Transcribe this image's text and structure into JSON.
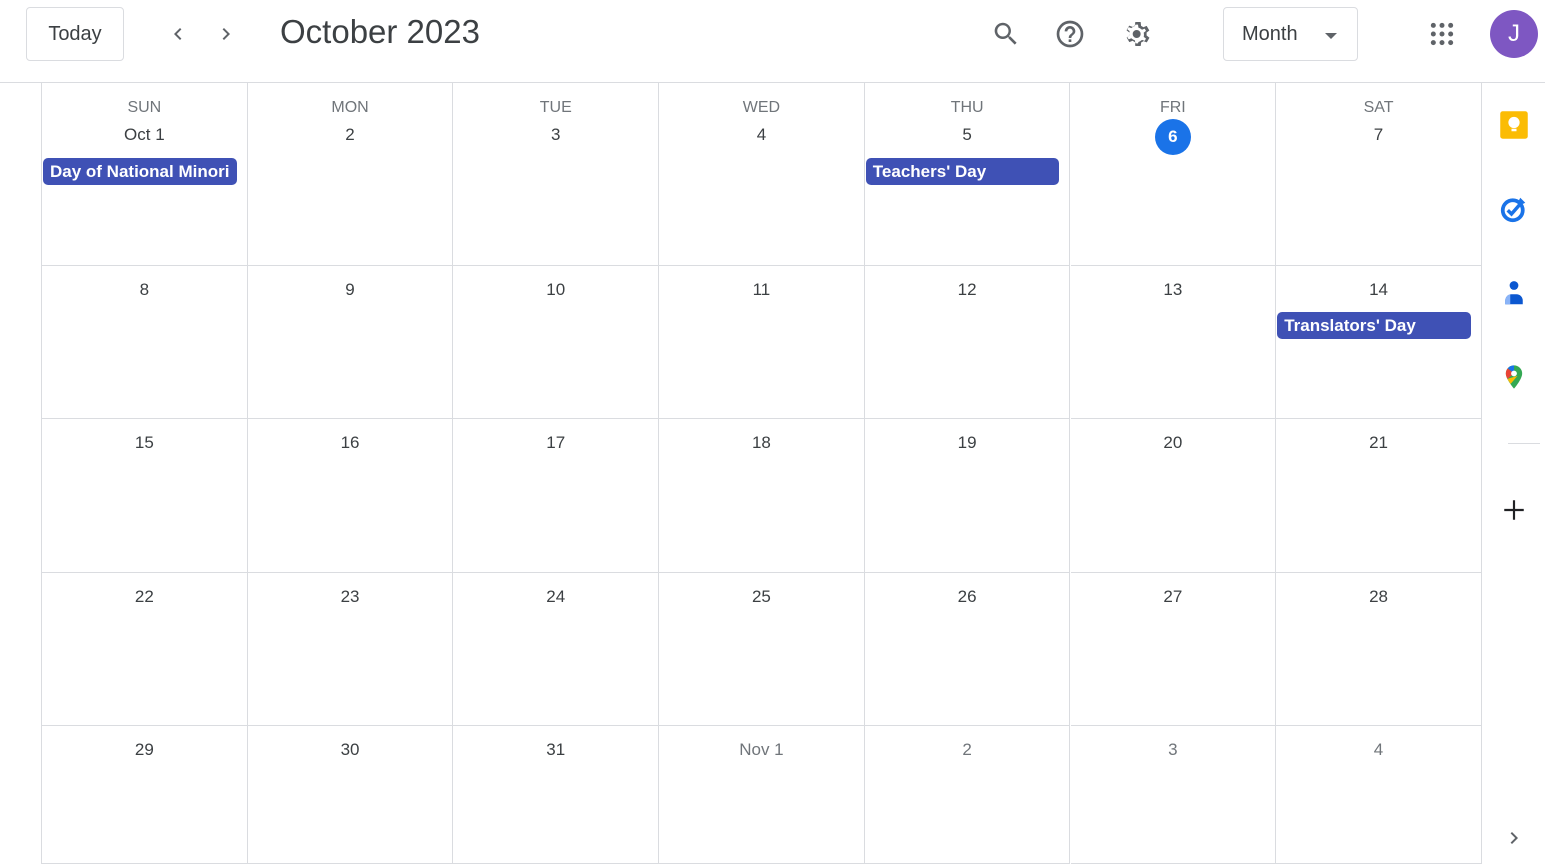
{
  "header": {
    "today_label": "Today",
    "prev_icon": "chevron-left-icon",
    "next_icon": "chevron-right-icon",
    "title": "October 2023",
    "search_icon": "search-icon",
    "help_icon": "help-icon",
    "settings_icon": "gear-icon",
    "view_selected": "Month",
    "apps_icon": "apps-grid-icon",
    "avatar_initial": "J",
    "avatar_color": "#7e57c2"
  },
  "calendar": {
    "weekdays": [
      "SUN",
      "MON",
      "TUE",
      "WED",
      "THU",
      "FRI",
      "SAT"
    ],
    "today_color": "#1a73e8",
    "event_color": "#3f51b5",
    "weeks": [
      [
        {
          "label": "Oct 1"
        },
        {
          "label": "2"
        },
        {
          "label": "3"
        },
        {
          "label": "4"
        },
        {
          "label": "5"
        },
        {
          "label": "6",
          "today": true
        },
        {
          "label": "7"
        }
      ],
      [
        {
          "label": "8"
        },
        {
          "label": "9"
        },
        {
          "label": "10"
        },
        {
          "label": "11"
        },
        {
          "label": "12"
        },
        {
          "label": "13"
        },
        {
          "label": "14"
        }
      ],
      [
        {
          "label": "15"
        },
        {
          "label": "16"
        },
        {
          "label": "17"
        },
        {
          "label": "18"
        },
        {
          "label": "19"
        },
        {
          "label": "20"
        },
        {
          "label": "21"
        }
      ],
      [
        {
          "label": "22"
        },
        {
          "label": "23"
        },
        {
          "label": "24"
        },
        {
          "label": "25"
        },
        {
          "label": "26"
        },
        {
          "label": "27"
        },
        {
          "label": "28"
        }
      ],
      [
        {
          "label": "29"
        },
        {
          "label": "30"
        },
        {
          "label": "31"
        },
        {
          "label": "Nov 1",
          "other": true
        },
        {
          "label": "2",
          "other": true
        },
        {
          "label": "3",
          "other": true
        },
        {
          "label": "4",
          "other": true
        }
      ]
    ],
    "events": [
      {
        "title": "Day of National Minori",
        "week": 0,
        "day": 0
      },
      {
        "title": "Teachers' Day",
        "week": 0,
        "day": 4
      },
      {
        "title": "Translators' Day",
        "week": 1,
        "day": 6
      }
    ]
  },
  "side_panel": {
    "items": [
      {
        "name": "keep-icon",
        "label": "Keep"
      },
      {
        "name": "tasks-icon",
        "label": "Tasks"
      },
      {
        "name": "contacts-icon",
        "label": "Contacts"
      },
      {
        "name": "maps-icon",
        "label": "Maps"
      }
    ],
    "add_icon": "plus-icon",
    "expand_icon": "chevron-right-icon"
  }
}
